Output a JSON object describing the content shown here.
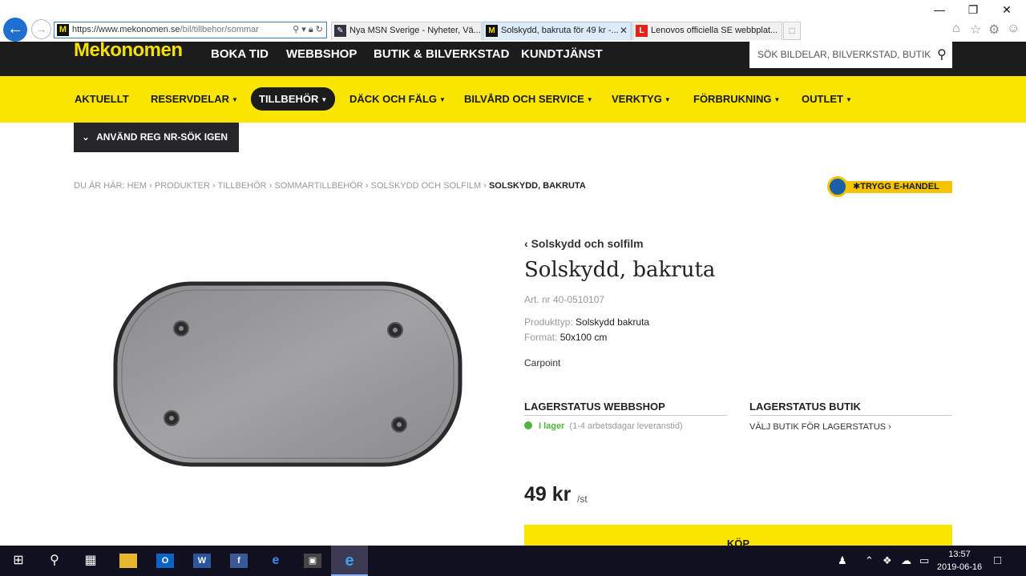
{
  "browser": {
    "url_main": "https://www.mekonomen.se",
    "url_path": "/bil/tillbehor/sommar",
    "tabs": [
      {
        "label": "Nya MSN Sverige - Nyheter, Vä..."
      },
      {
        "label": "Solskydd, bakruta för 49 kr -..."
      },
      {
        "label": "Lenovos officiella SE webbplat..."
      }
    ]
  },
  "site": {
    "logo": "Mekonomen",
    "top_nav": [
      "BOKA TID",
      "WEBBSHOP",
      "BUTIK & BILVERKSTAD",
      "KUNDTJÄNST"
    ],
    "search_placeholder": "SÖK BILDELAR, BILVERKSTAD, BUTIK",
    "main_nav": [
      "AKTUELLT",
      "RESERVDELAR",
      "TILLBEHÖR",
      "DÄCK OCH FÄLG",
      "BILVÅRD OCH SERVICE",
      "VERKTYG",
      "FÖRBRUKNING",
      "OUTLET"
    ],
    "reg_button": "ANVÄND REG NR-SÖK IGEN",
    "breadcrumb": {
      "prefix": "DU ÄR HÄR:",
      "items": [
        "HEM",
        "PRODUKTER",
        "TILLBEHÖR",
        "SOMMARTILLBEHÖR",
        "SOLSKYDD OCH SOLFILM"
      ],
      "current": "SOLSKYDD, BAKRUTA"
    },
    "trust_badge": "TRYGG E-HANDEL"
  },
  "product": {
    "back_link": "Solskydd och solfilm",
    "title": "Solskydd, bakruta",
    "art_nr": "Art. nr 40-0510107",
    "specs": [
      {
        "key": "Produkttyp:",
        "value": "Solskydd bakruta"
      },
      {
        "key": "Format:",
        "value": "50x100 cm"
      }
    ],
    "brand": "Carpoint",
    "stock_webshop_heading": "LAGERSTATUS WEBBSHOP",
    "stock_store_heading": "LAGERSTATUS BUTIK",
    "stock_status": "I lager",
    "stock_detail": "(1-4 arbetsdagar leveranstid)",
    "store_link": "VÄLJ BUTIK FÖR LAGERSTATUS ›",
    "price": "49 kr",
    "price_unit": "/st",
    "buy_label": "KÖP"
  },
  "taskbar": {
    "time": "13:57",
    "date": "2019-06-16"
  }
}
